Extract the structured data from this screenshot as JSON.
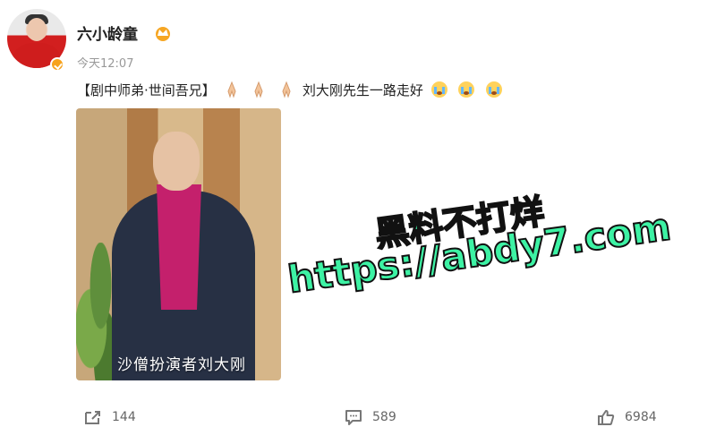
{
  "user": {
    "name": "六小龄童",
    "timestamp": "今天12:07",
    "verified_color": "#f7a21b",
    "crown_icon": "crown-icon"
  },
  "post": {
    "title": "【剧中师弟·世间吾兄】",
    "message": "刘大刚先生一路走好",
    "image_caption": "沙僧扮演者刘大刚"
  },
  "watermark": {
    "line1": "黑料不打烊",
    "line2": "https://abdy7.com"
  },
  "actions": {
    "share_count": "144",
    "comment_count": "589",
    "like_count": "6984"
  }
}
